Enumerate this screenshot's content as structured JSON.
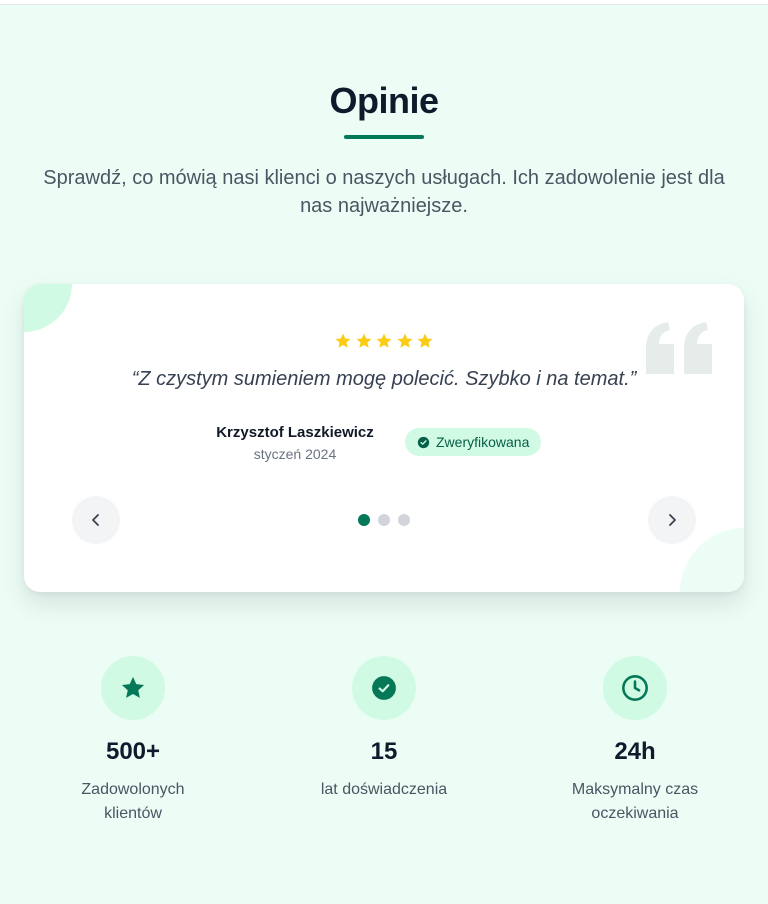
{
  "section": {
    "title": "Opinie",
    "subtitle": "Sprawdź, co mówią nasi klienci o naszych usługach. Ich zadowolenie jest dla nas najważniejsze."
  },
  "testimonial": {
    "rating": 5,
    "rating_max": 5,
    "quote": "“Z czystym sumieniem mogę polecić. Szybko i na temat.”",
    "author": "Krzysztof Laszkiewicz",
    "date": "styczeń 2024",
    "badge": "Zweryfikowana",
    "slide_count": 3,
    "active_slide": 1
  },
  "stats": [
    {
      "icon": "star-icon",
      "value": "500+",
      "label": "Zadowolonych klientów"
    },
    {
      "icon": "check-badge-icon",
      "value": "15",
      "label": "lat doświadczenia"
    },
    {
      "icon": "clock-icon",
      "value": "24h",
      "label": "Maksymalny czas oczekiwania"
    }
  ],
  "colors": {
    "background": "#ecfdf5",
    "accent": "#047857",
    "accent_light": "#d1fae5",
    "star": "#facc15",
    "title": "#0f1b2d"
  }
}
